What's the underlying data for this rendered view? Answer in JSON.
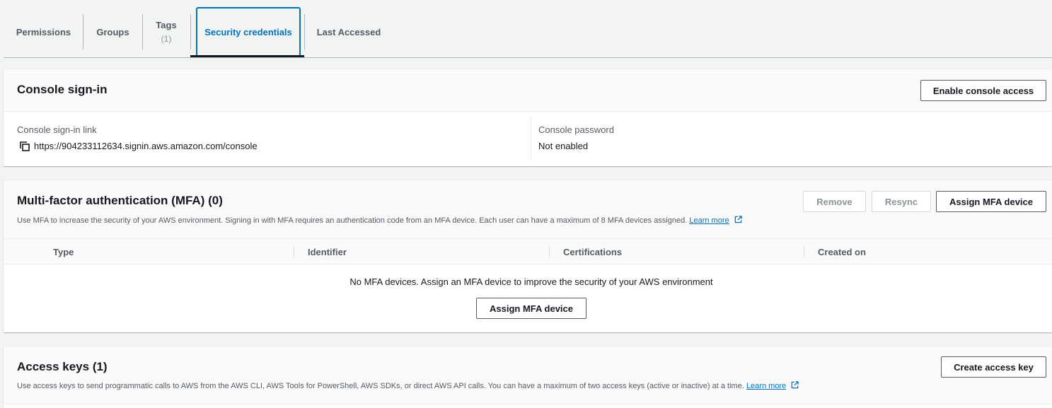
{
  "tabs": [
    {
      "label": "Permissions",
      "count": ""
    },
    {
      "label": "Groups",
      "count": ""
    },
    {
      "label": "Tags",
      "count": "(1)"
    },
    {
      "label": "Security credentials",
      "count": ""
    },
    {
      "label": "Last Accessed",
      "count": ""
    }
  ],
  "console_signin": {
    "title": "Console sign-in",
    "enable_button": "Enable console access",
    "link_label": "Console sign-in link",
    "link_value": "https://904233112634.signin.aws.amazon.com/console",
    "password_label": "Console password",
    "password_value": "Not enabled"
  },
  "mfa": {
    "title": "Multi-factor authentication (MFA) (0)",
    "description": "Use MFA to increase the security of your AWS environment. Signing in with MFA requires an authentication code from an MFA device. Each user can have a maximum of 8 MFA devices assigned.",
    "learn_more": "Learn more",
    "remove_button": "Remove",
    "resync_button": "Resync",
    "assign_button": "Assign MFA device",
    "columns": [
      "Type",
      "Identifier",
      "Certifications",
      "Created on"
    ],
    "empty_text": "No MFA devices. Assign an MFA device to improve the security of your AWS environment",
    "empty_button": "Assign MFA device"
  },
  "access_keys": {
    "title": "Access keys (1)",
    "description": "Use access keys to send programmatic calls to AWS from the AWS CLI, AWS Tools for PowerShell, AWS SDKs, or direct AWS API calls. You can have a maximum of two access keys (active or inactive) at a time.",
    "learn_more": "Learn more",
    "create_button": "Create access key"
  },
  "colors": {
    "accent": "#0073bb",
    "text": "#16191f",
    "muted": "#545b64",
    "background": "#f2f3f3"
  }
}
